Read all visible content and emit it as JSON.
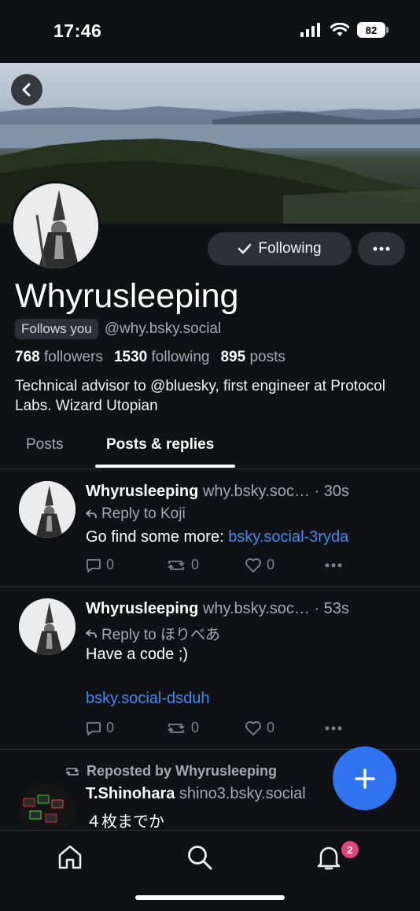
{
  "status_bar": {
    "time": "17:46",
    "battery": "82"
  },
  "profile": {
    "display_name": "Whyrusleeping",
    "follows_you": "Follows you",
    "handle": "@why.bsky.social",
    "follow_label": "Following",
    "followers_count": "768",
    "followers_label": "followers",
    "following_count": "1530",
    "following_label": "following",
    "posts_count": "895",
    "posts_label": "posts",
    "bio": "Technical advisor to @bluesky, first engineer at Protocol Labs. Wizard Utopian"
  },
  "tabs": [
    {
      "label": "Posts",
      "active": false
    },
    {
      "label": "Posts & replies",
      "active": true
    }
  ],
  "posts": [
    {
      "author": "Whyrusleeping",
      "handle": "why.bsky.soc…",
      "time": "· 30s",
      "reply_to": "Reply to Koji",
      "text": "Go find some more: ",
      "link": "bsky.social-3ryda",
      "replies": "0",
      "reposts": "0",
      "likes": "0"
    },
    {
      "author": "Whyrusleeping",
      "handle": "why.bsky.soc…",
      "time": "· 53s",
      "reply_to": "Reply to ほりべあ",
      "text": "Have a code ;)",
      "link": "bsky.social-dsduh",
      "replies": "0",
      "reposts": "0",
      "likes": "0"
    },
    {
      "repost_label": "Reposted by Whyrusleeping",
      "author": "T.Shinohara",
      "handle": "shino3.bsky.social",
      "text": "４枚までか"
    }
  ],
  "nav": {
    "notif_count": "2"
  },
  "icons": {
    "back": "chevron-left-icon",
    "check": "check-icon",
    "more": "ellipsis-icon",
    "reply": "speech-bubble-icon",
    "repost": "repost-arrows-icon",
    "like": "heart-icon",
    "compose": "plus-icon",
    "home": "home-icon",
    "search": "search-icon",
    "notifications": "bell-icon"
  },
  "colors": {
    "accent": "#2f73f0",
    "link": "#3d8cf5",
    "badge": "#e0457b",
    "background": "#101114"
  }
}
